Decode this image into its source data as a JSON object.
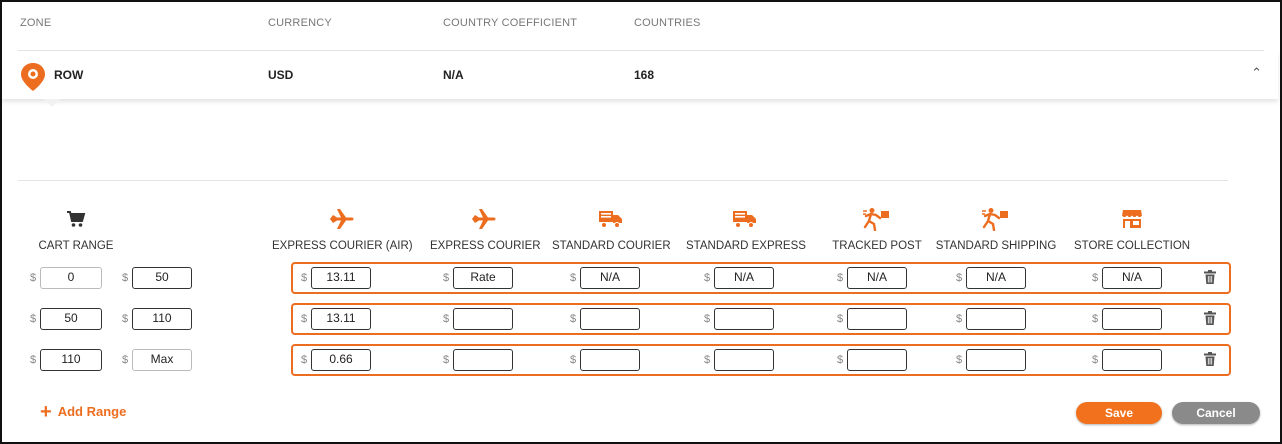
{
  "table_headers": {
    "zone": "ZONE",
    "currency": "CURRENCY",
    "coefficient": "COUNTRY COEFFICIENT",
    "countries": "COUNTRIES"
  },
  "zone_row": {
    "zone": "ROW",
    "currency": "USD",
    "coefficient": "N/A",
    "countries": "168"
  },
  "columns": {
    "cart_range": "CART RANGE",
    "express_air": "EXPRESS COURIER (AIR)",
    "express_courier": "EXPRESS COURIER",
    "standard_courier": "STANDARD COURIER",
    "standard_express": "STANDARD EXPRESS",
    "tracked_post": "TRACKED POST",
    "standard_shipping": "STANDARD SHIPPING",
    "store_collection": "STORE COLLECTION"
  },
  "currency_symbol": "$",
  "ranges": [
    {
      "min": "0",
      "max": "50",
      "rates": [
        "13.11",
        "Rate",
        "N/A",
        "N/A",
        "N/A",
        "N/A",
        "N/A"
      ]
    },
    {
      "min": "50",
      "max": "110",
      "rates": [
        "13.11",
        "",
        "",
        "",
        "",
        "",
        ""
      ]
    },
    {
      "min": "110",
      "max": "Max",
      "rates": [
        "0.66",
        "",
        "",
        "",
        "",
        "",
        ""
      ]
    }
  ],
  "actions": {
    "add_range": "Add Range",
    "save": "Save",
    "cancel": "Cancel"
  },
  "colors": {
    "accent": "#ec6d20",
    "cancel": "#8a8a8a"
  }
}
